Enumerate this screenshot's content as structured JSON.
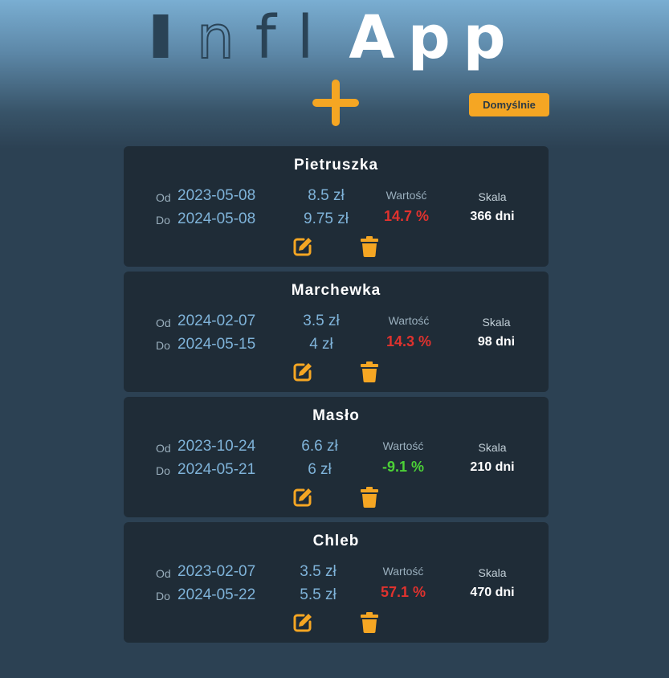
{
  "app": {
    "title_parts": [
      "I",
      "n",
      "fl",
      "App"
    ],
    "default_button": "Domyślnie",
    "accent": "#f5a623",
    "add_icon": "plus-icon",
    "edit_icon": "edit-icon",
    "delete_icon": "trash-icon"
  },
  "labels": {
    "from": "Od",
    "to": "Do",
    "value": "Wartość",
    "scale": "Skala"
  },
  "colors": {
    "positive_change": "#e0322e",
    "negative_change": "#4cd137"
  },
  "items": [
    {
      "name": "Pietruszka",
      "date_from": "2023-05-08",
      "date_to": "2024-05-08",
      "price_from": "8.5 zł",
      "price_to": "9.75 zł",
      "value": "14.7 %",
      "scale": "366 dni",
      "trend": "up"
    },
    {
      "name": "Marchewka",
      "date_from": "2024-02-07",
      "date_to": "2024-05-15",
      "price_from": "3.5 zł",
      "price_to": "4 zł",
      "value": "14.3 %",
      "scale": "98 dni",
      "trend": "up"
    },
    {
      "name": "Masło",
      "date_from": "2023-10-24",
      "date_to": "2024-05-21",
      "price_from": "6.6 zł",
      "price_to": "6 zł",
      "value": "-9.1 %",
      "scale": "210 dni",
      "trend": "down"
    },
    {
      "name": "Chleb",
      "date_from": "2023-02-07",
      "date_to": "2024-05-22",
      "price_from": "3.5 zł",
      "price_to": "5.5 zł",
      "value": "57.1 %",
      "scale": "470 dni",
      "trend": "up"
    }
  ]
}
